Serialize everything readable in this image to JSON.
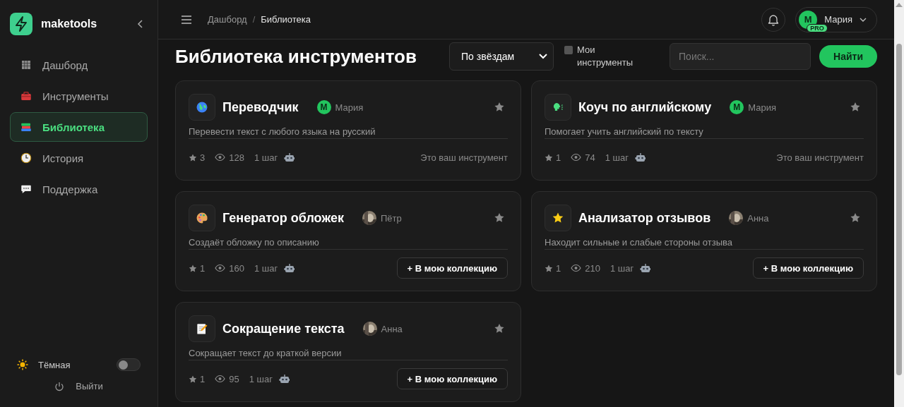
{
  "sidebar": {
    "brand": "maketools",
    "items": [
      {
        "label": "Дашборд",
        "kind": "grid",
        "selected": false
      },
      {
        "label": "Инструменты",
        "kind": "toolbox",
        "selected": false
      },
      {
        "label": "Библиотека",
        "kind": "books",
        "selected": true
      },
      {
        "label": "История",
        "kind": "clock",
        "selected": false
      },
      {
        "label": "Поддержка",
        "kind": "chat",
        "selected": false
      }
    ],
    "theme": {
      "label": "Тёмная",
      "on": false
    },
    "logout": "Выйти"
  },
  "header": {
    "breadcrumbs": [
      "Дашборд",
      "Библиотека"
    ],
    "separator": "/",
    "user": {
      "initial": "M",
      "name": "Мария",
      "badge": "PRO"
    }
  },
  "page": {
    "title": "Библиотека инструментов",
    "sort": "По звёздам",
    "mine": {
      "label": "Мои инструменты",
      "checked": false
    },
    "search": {
      "placeholder": "Поиск..."
    },
    "search_button": "Найти"
  },
  "cards": [
    {
      "kind": "globe",
      "title": "Переводчик",
      "author": {
        "name": "Мария",
        "initial": "M",
        "kind": "letter"
      },
      "favorited": false,
      "description": "Перевести текст с любого языка на русский",
      "star_count": "3",
      "views": "128",
      "steps": "1 шаг",
      "note": "Это ваш инструмент"
    },
    {
      "kind": "speech",
      "title": "Коуч по английскому",
      "author": {
        "name": "Мария",
        "initial": "M",
        "kind": "letter"
      },
      "favorited": false,
      "description": "Помогает учить английский по тексту",
      "star_count": "1",
      "views": "74",
      "steps": "1 шаг",
      "note": "Это ваш инструмент"
    },
    {
      "kind": "palette",
      "title": "Генератор обложек",
      "author": {
        "name": "Пётр",
        "kind": "picture"
      },
      "favorited": false,
      "description": "Создаёт обложку по описанию",
      "star_count": "1",
      "views": "160",
      "steps": "1 шаг",
      "action": "+ В мою коллекцию"
    },
    {
      "kind": "star",
      "title": "Анализатор отзывов",
      "author": {
        "name": "Анна",
        "kind": "picture"
      },
      "favorited": false,
      "description": "Находит сильные и слабые стороны отзыва",
      "star_count": "1",
      "views": "210",
      "steps": "1 шаг",
      "action": "+ В мою коллекцию"
    },
    {
      "kind": "memo",
      "title": "Сокращение текста",
      "author": {
        "name": "Анна",
        "kind": "picture"
      },
      "favorited": false,
      "description": "Сокращает текст до краткой версии",
      "star_count": "1",
      "views": "95",
      "steps": "1 шаг",
      "action": "+ В мою коллекцию"
    }
  ]
}
